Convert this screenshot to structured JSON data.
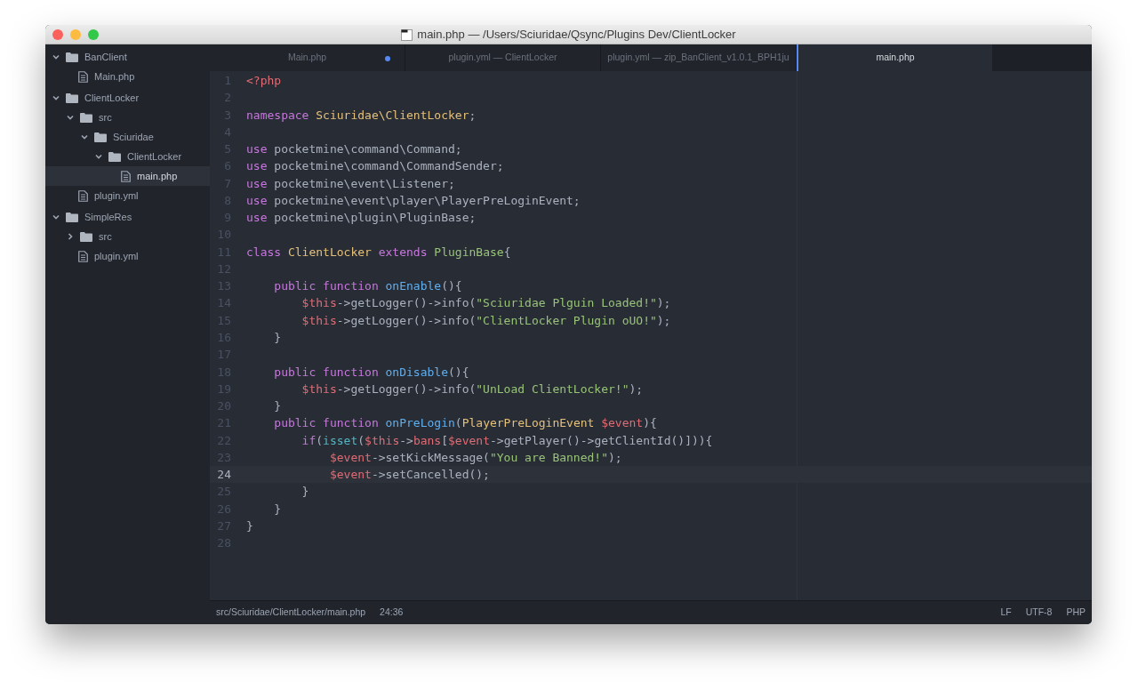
{
  "window": {
    "title": "main.php — /Users/Sciuridae/Qsync/Plugins Dev/ClientLocker"
  },
  "tree": [
    {
      "kind": "folder",
      "name": "BanClient",
      "expanded": true,
      "selected": false,
      "children": [
        {
          "kind": "file",
          "name": "Main.php",
          "selected": false
        }
      ]
    },
    {
      "kind": "folder",
      "name": "ClientLocker",
      "expanded": true,
      "selected": false,
      "children": [
        {
          "kind": "folder",
          "name": "src",
          "expanded": true,
          "selected": false,
          "children": [
            {
              "kind": "folder",
              "name": "Sciuridae",
              "expanded": true,
              "selected": false,
              "children": [
                {
                  "kind": "folder",
                  "name": "ClientLocker",
                  "expanded": true,
                  "selected": false,
                  "children": [
                    {
                      "kind": "file",
                      "name": "main.php",
                      "selected": true
                    }
                  ]
                }
              ]
            }
          ]
        },
        {
          "kind": "file",
          "name": "plugin.yml",
          "selected": false
        }
      ]
    },
    {
      "kind": "folder",
      "name": "SimpleRes",
      "expanded": true,
      "selected": false,
      "children": [
        {
          "kind": "folder",
          "name": "src",
          "expanded": false,
          "selected": false
        },
        {
          "kind": "file",
          "name": "plugin.yml",
          "selected": false
        }
      ]
    }
  ],
  "tabs": [
    {
      "label": "Main.php",
      "selected": false,
      "modified": true
    },
    {
      "label": "plugin.yml — ClientLocker",
      "selected": false,
      "modified": false
    },
    {
      "label": "plugin.yml — zip_BanClient_v1.0.1_BPH1ju",
      "selected": false,
      "modified": false
    },
    {
      "label": "main.php",
      "selected": true,
      "modified": false
    }
  ],
  "code": [
    {
      "number": "1",
      "selected": false,
      "tokens": [
        {
          "kind": "tag",
          "text": "<?php"
        }
      ]
    },
    {
      "number": "2",
      "selected": false
    },
    {
      "number": "3",
      "selected": false,
      "tokens": [
        {
          "kind": "keyword",
          "text": "namespace "
        },
        {
          "kind": "class",
          "text": "Sciuridae\\ClientLocker"
        },
        {
          "kind": "plain",
          "text": ";"
        }
      ]
    },
    {
      "number": "4",
      "selected": false
    },
    {
      "number": "5",
      "selected": false,
      "tokens": [
        {
          "kind": "keyword",
          "text": "use "
        },
        {
          "kind": "plain",
          "text": "pocketmine\\command\\Command;"
        }
      ]
    },
    {
      "number": "6",
      "selected": false,
      "tokens": [
        {
          "kind": "keyword",
          "text": "use "
        },
        {
          "kind": "plain",
          "text": "pocketmine\\command\\CommandSender;"
        }
      ]
    },
    {
      "number": "7",
      "selected": false,
      "tokens": [
        {
          "kind": "keyword",
          "text": "use "
        },
        {
          "kind": "plain",
          "text": "pocketmine\\event\\Listener;"
        }
      ]
    },
    {
      "number": "8",
      "selected": false,
      "tokens": [
        {
          "kind": "keyword",
          "text": "use "
        },
        {
          "kind": "plain",
          "text": "pocketmine\\event\\player\\PlayerPreLoginEvent;"
        }
      ]
    },
    {
      "number": "9",
      "selected": false,
      "tokens": [
        {
          "kind": "keyword",
          "text": "use "
        },
        {
          "kind": "plain",
          "text": "pocketmine\\plugin\\PluginBase;"
        }
      ]
    },
    {
      "number": "10",
      "selected": false
    },
    {
      "number": "11",
      "selected": false,
      "tokens": [
        {
          "kind": "keyword",
          "text": "class "
        },
        {
          "kind": "class",
          "text": "ClientLocker"
        },
        {
          "kind": "keyword",
          "text": " extends "
        },
        {
          "kind": "inherited",
          "text": "PluginBase"
        },
        {
          "kind": "plain",
          "text": "{"
        }
      ]
    },
    {
      "number": "12",
      "selected": false
    },
    {
      "number": "13",
      "selected": false,
      "tokens": [
        {
          "kind": "keyword",
          "text": "    public function "
        },
        {
          "kind": "function",
          "text": "onEnable"
        },
        {
          "kind": "plain",
          "text": "(){"
        }
      ]
    },
    {
      "number": "14",
      "selected": false,
      "tokens": [
        {
          "kind": "variable",
          "text": "        $this"
        },
        {
          "kind": "plain",
          "text": "->getLogger()->info("
        },
        {
          "kind": "string",
          "text": "\"Sciuridae Plguin Loaded!\""
        },
        {
          "kind": "plain",
          "text": ");"
        }
      ]
    },
    {
      "number": "15",
      "selected": false,
      "tokens": [
        {
          "kind": "variable",
          "text": "        $this"
        },
        {
          "kind": "plain",
          "text": "->getLogger()->info("
        },
        {
          "kind": "string",
          "text": "\"ClientLocker Plugin oUO!\""
        },
        {
          "kind": "plain",
          "text": ");"
        }
      ]
    },
    {
      "number": "16",
      "selected": false,
      "tokens": [
        {
          "kind": "plain",
          "text": "    }"
        }
      ]
    },
    {
      "number": "17",
      "selected": false
    },
    {
      "number": "18",
      "selected": false,
      "tokens": [
        {
          "kind": "keyword",
          "text": "    public function "
        },
        {
          "kind": "function",
          "text": "onDisable"
        },
        {
          "kind": "plain",
          "text": "(){"
        }
      ]
    },
    {
      "number": "19",
      "selected": false,
      "tokens": [
        {
          "kind": "variable",
          "text": "        $this"
        },
        {
          "kind": "plain",
          "text": "->getLogger()->info("
        },
        {
          "kind": "string",
          "text": "\"UnLoad ClientLocker!\""
        },
        {
          "kind": "plain",
          "text": ");"
        }
      ]
    },
    {
      "number": "20",
      "selected": false,
      "tokens": [
        {
          "kind": "plain",
          "text": "    }"
        }
      ]
    },
    {
      "number": "21",
      "selected": false,
      "tokens": [
        {
          "kind": "keyword",
          "text": "    public function "
        },
        {
          "kind": "function",
          "text": "onPreLogin"
        },
        {
          "kind": "plain",
          "text": "("
        },
        {
          "kind": "class",
          "text": "PlayerPreLoginEvent"
        },
        {
          "kind": "variable",
          "text": " $event"
        },
        {
          "kind": "plain",
          "text": "){"
        }
      ]
    },
    {
      "number": "22",
      "selected": false,
      "tokens": [
        {
          "kind": "keyword",
          "text": "        if"
        },
        {
          "kind": "plain",
          "text": "("
        },
        {
          "kind": "builtin",
          "text": "isset"
        },
        {
          "kind": "plain",
          "text": "("
        },
        {
          "kind": "variable",
          "text": "$this"
        },
        {
          "kind": "plain",
          "text": "->"
        },
        {
          "kind": "variable",
          "text": "bans"
        },
        {
          "kind": "plain",
          "text": "["
        },
        {
          "kind": "variable",
          "text": "$event"
        },
        {
          "kind": "plain",
          "text": "->getPlayer()->getClientId()])){"
        }
      ]
    },
    {
      "number": "23",
      "selected": false,
      "tokens": [
        {
          "kind": "variable",
          "text": "            $event"
        },
        {
          "kind": "plain",
          "text": "->setKickMessage("
        },
        {
          "kind": "string",
          "text": "\"You are Banned!\""
        },
        {
          "kind": "plain",
          "text": ");"
        }
      ]
    },
    {
      "number": "24",
      "selected": true,
      "tokens": [
        {
          "kind": "variable",
          "text": "            $event"
        },
        {
          "kind": "plain",
          "text": "->setCancelled();"
        }
      ]
    },
    {
      "number": "25",
      "selected": false,
      "tokens": [
        {
          "kind": "plain",
          "text": "        }"
        }
      ]
    },
    {
      "number": "26",
      "selected": false,
      "tokens": [
        {
          "kind": "plain",
          "text": "    }"
        }
      ]
    },
    {
      "number": "27",
      "selected": false,
      "tokens": [
        {
          "kind": "plain",
          "text": "}"
        }
      ]
    },
    {
      "number": "28",
      "selected": false
    }
  ],
  "status_bar": {
    "path": "src/Sciuridae/ClientLocker/main.php",
    "cursor": "24:36",
    "line_ending": "LF",
    "encoding": "UTF-8",
    "grammar": "PHP"
  }
}
